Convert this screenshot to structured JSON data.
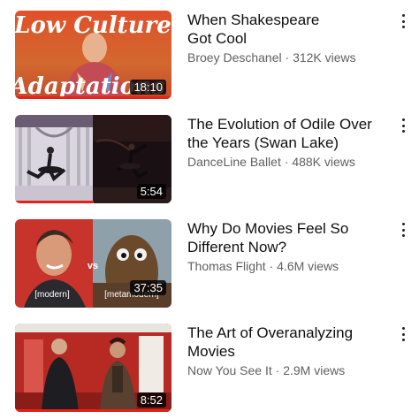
{
  "videos": [
    {
      "title_line1": "When Shakespeare",
      "title_line2": "Got Cool",
      "channel": "Broey Deschanel",
      "views": "312K views",
      "separator": " · ",
      "duration": "18:10",
      "thumb_text_top": "Low Culture",
      "thumb_text_bottom": "Adaptations",
      "watched_fraction": 1.0
    },
    {
      "title_line1": "The Evolution of Odile Over",
      "title_line2": "the Years (Swan Lake)",
      "channel": "DanceLine Ballet",
      "views": "488K views",
      "separator": " · ",
      "duration": "5:54",
      "watched_fraction": 0.5
    },
    {
      "title_line1": "Why Do Movies Feel So",
      "title_line2": "Different Now?",
      "channel": "Thomas Flight",
      "views": "4.6M views",
      "separator": " · ",
      "duration": "37:35",
      "thumb_label_left": "[modern]",
      "thumb_label_vs": "vs",
      "thumb_label_right": "[metamodern]",
      "watched_fraction": 0.0
    },
    {
      "title_line1": "The Art of Overanalyzing",
      "title_line2": "Movies",
      "channel": "Now You See It",
      "views": "2.9M views",
      "separator": " · ",
      "duration": "8:52",
      "watched_fraction": 1.0
    }
  ],
  "colors": {
    "progress": "#e62117",
    "title": "#0f0f0f",
    "meta": "#606060"
  }
}
